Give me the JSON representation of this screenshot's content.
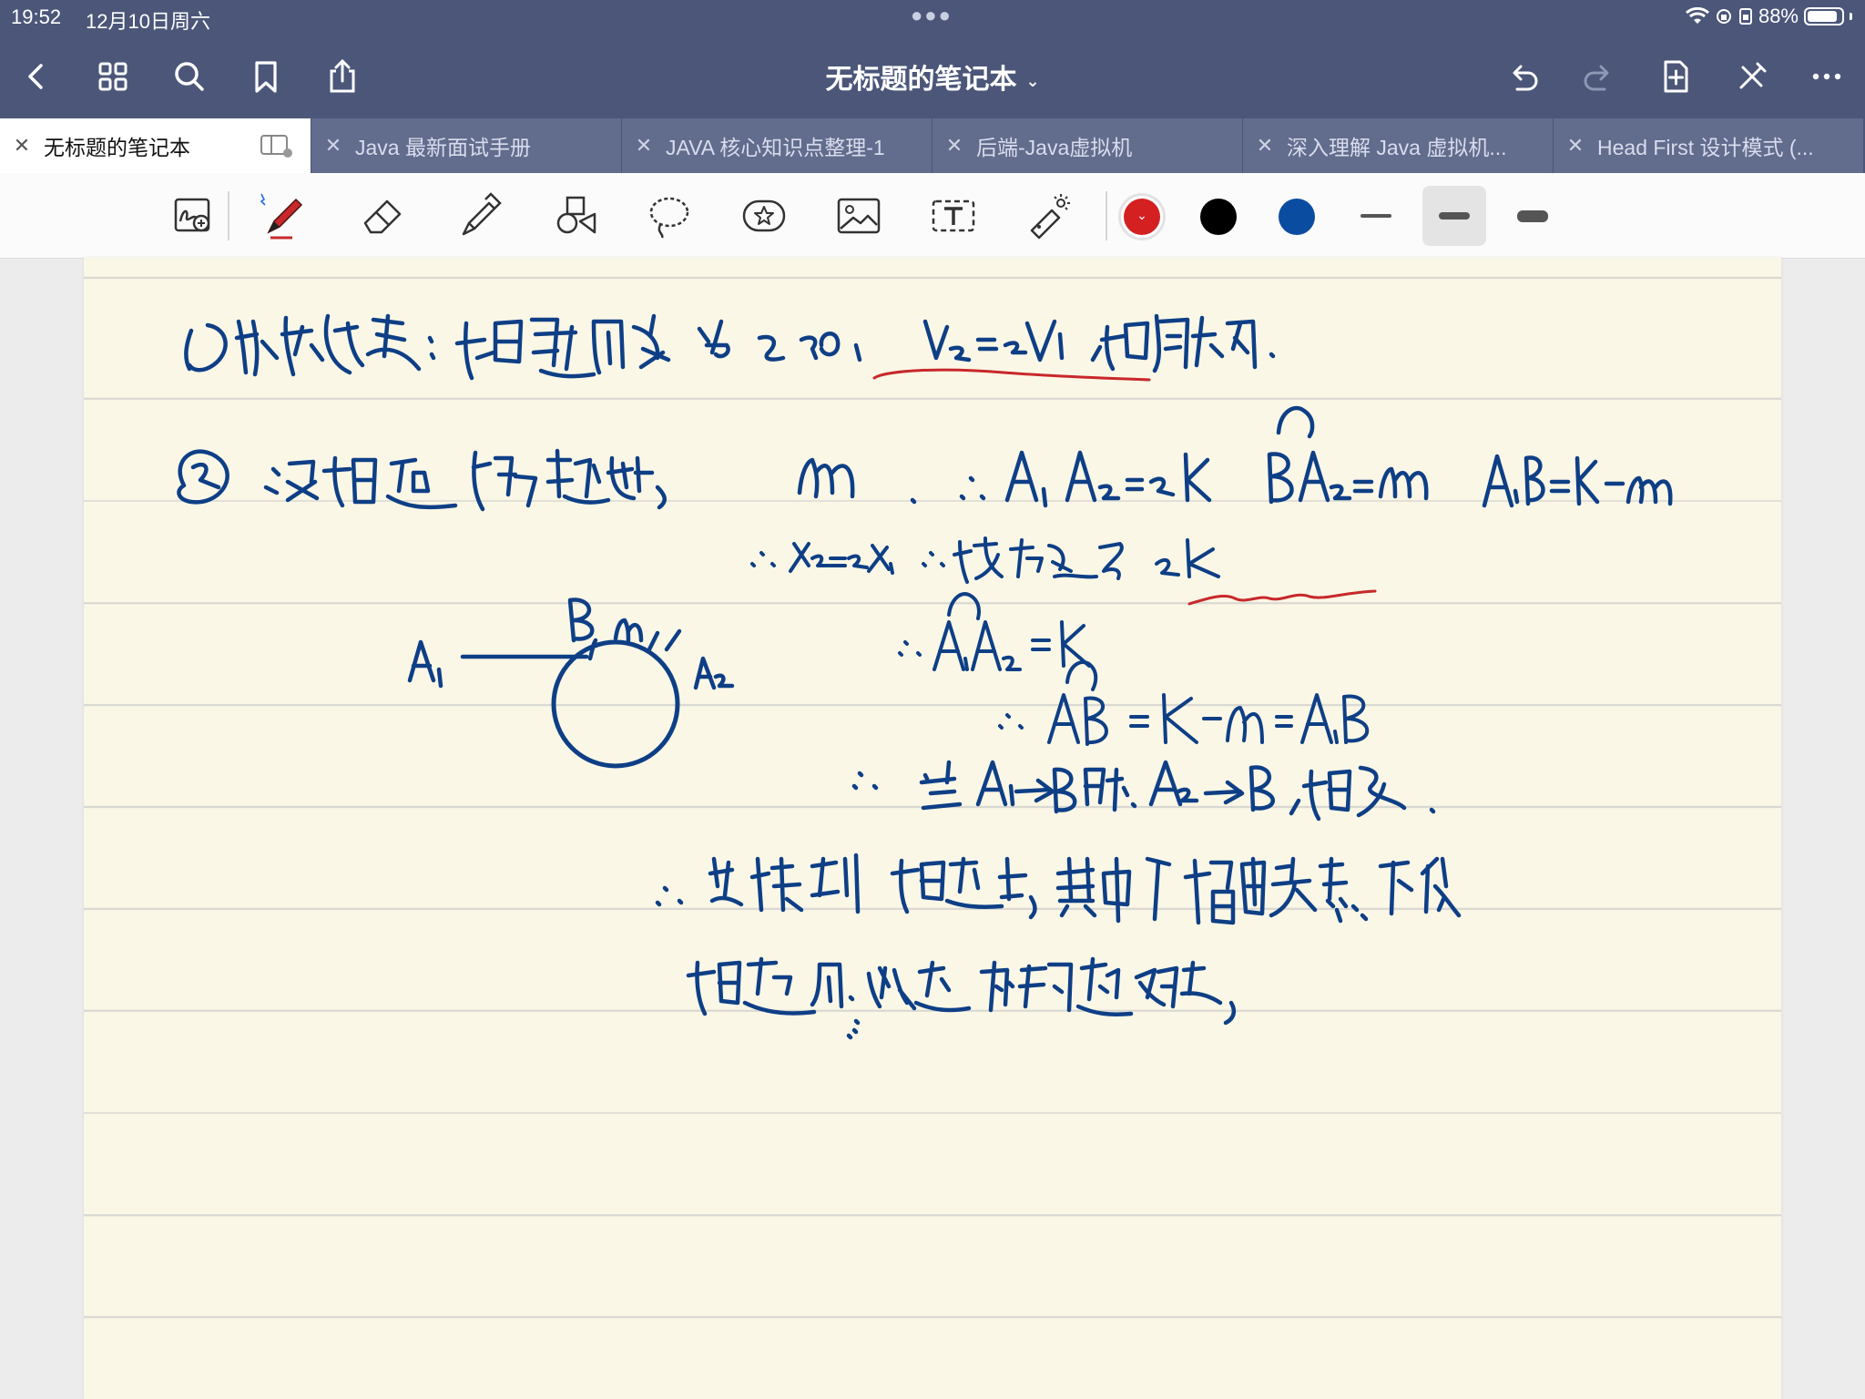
{
  "status": {
    "time": "19:52",
    "date": "12月10日周六",
    "battery": "88%",
    "battery_level": 0.88
  },
  "header": {
    "title": "无标题的笔记本",
    "back_icon": "chevron-left-icon",
    "grid_icon": "grid-icon",
    "search_icon": "search-icon",
    "bookmark_icon": "bookmark-icon",
    "share_icon": "share-icon",
    "undo_icon": "undo-icon",
    "redo_icon": "redo-icon",
    "add_page_icon": "add-page-icon",
    "close_pen_icon": "pencil-off-icon",
    "more_icon": "more-icon"
  },
  "tabs": [
    {
      "label": "无标题的笔记本",
      "active": true
    },
    {
      "label": "Java 最新面试手册",
      "active": false
    },
    {
      "label": "JAVA 核心知识点整理-1",
      "active": false
    },
    {
      "label": "后端-Java虚拟机",
      "active": false
    },
    {
      "label": "深入理解 Java 虚拟机...",
      "active": false
    },
    {
      "label": "Head First 设计模式 (...",
      "active": false
    }
  ],
  "toolbar": {
    "tools": [
      "zoom-ink-icon",
      "pen-icon",
      "eraser-icon",
      "highlighter-icon",
      "shapes-icon",
      "lasso-icon",
      "sticker-icon",
      "image-icon",
      "text-icon",
      "laser-pointer-icon"
    ],
    "selected_tool": "pen-icon",
    "colors": [
      "#d42020",
      "#000000",
      "#0a4da0"
    ],
    "selected_color": "#d42020",
    "selected_width": 2
  },
  "note": {
    "ink_color": "#0e3f86",
    "highlight_color": "#c8282b"
  }
}
